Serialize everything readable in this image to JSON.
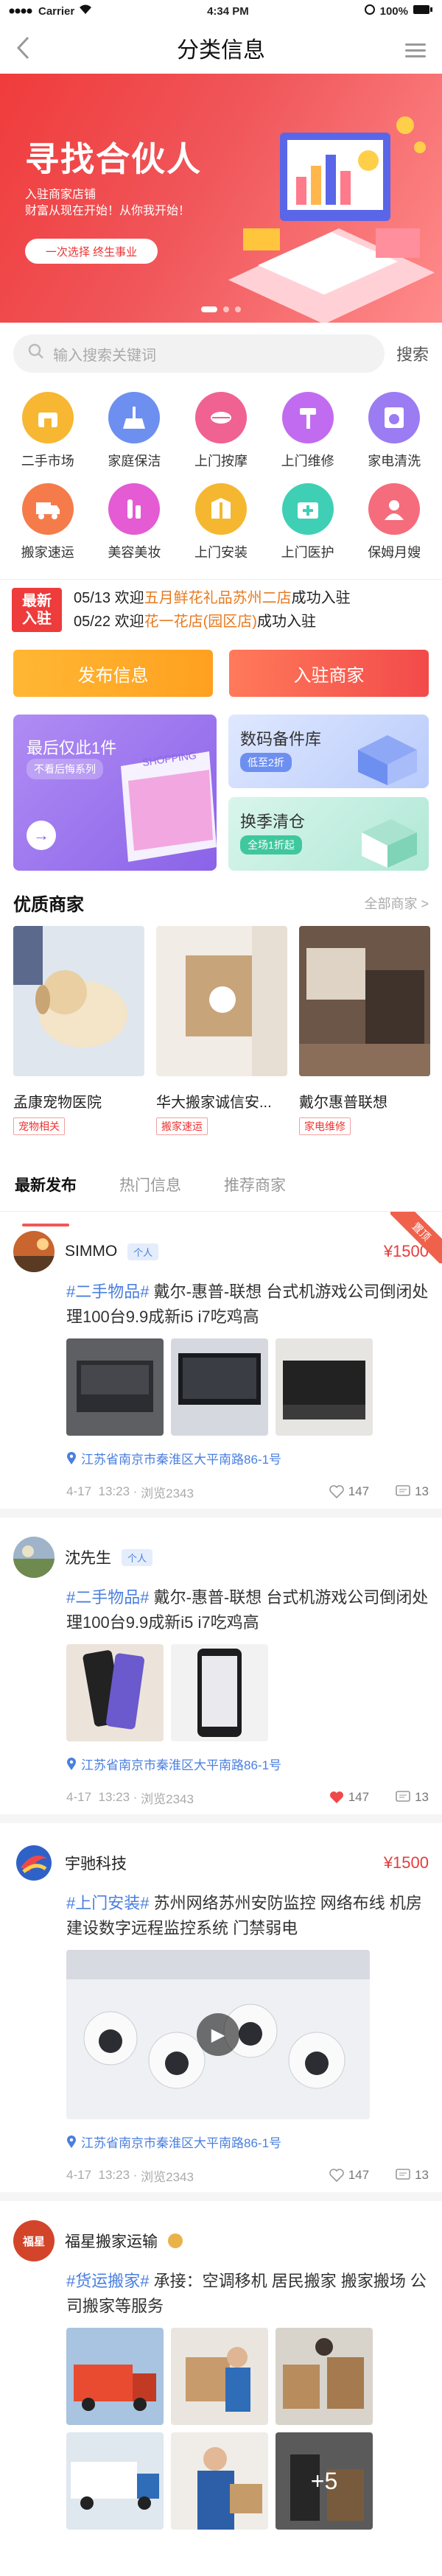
{
  "status_bar": {
    "carrier": "Carrier",
    "time": "4:34 PM",
    "battery": "100%"
  },
  "nav": {
    "title": "分类信息"
  },
  "banner": {
    "title": "寻找合伙人",
    "line1": "入驻商家店铺",
    "line2": "财富从现在开始！从你我开始！",
    "pill": "一次选择 终生事业"
  },
  "search": {
    "placeholder": "输入搜索关键词",
    "button": "搜索"
  },
  "categories": [
    {
      "label": "二手市场",
      "icon": "store-icon",
      "color": "#f7b733"
    },
    {
      "label": "家庭保洁",
      "icon": "broom-icon",
      "color": "#6d8ff0"
    },
    {
      "label": "上门按摩",
      "icon": "lips-icon",
      "color": "#f06292"
    },
    {
      "label": "上门维修",
      "icon": "hammer-icon",
      "color": "#c16cf0"
    },
    {
      "label": "家电清洗",
      "icon": "washer-icon",
      "color": "#9b7cf2"
    },
    {
      "label": "搬家速运",
      "icon": "truck-icon",
      "color": "#f57c4a"
    },
    {
      "label": "美容美妆",
      "icon": "makeup-icon",
      "color": "#e45bd3"
    },
    {
      "label": "上门安装",
      "icon": "box-icon",
      "color": "#f5b730"
    },
    {
      "label": "上门医护",
      "icon": "medical-icon",
      "color": "#3fcfb5"
    },
    {
      "label": "保姆月嫂",
      "icon": "nanny-icon",
      "color": "#f56c7c"
    }
  ],
  "news": {
    "badge_line1": "最新",
    "badge_line2": "入驻",
    "items": [
      {
        "date": "05/13",
        "pre": "欢迎",
        "name": "五月鲜花礼品苏州二店",
        "post": "成功入驻"
      },
      {
        "date": "05/22",
        "pre": "欢迎",
        "name": "花一花店(园区店)",
        "post": "成功入驻"
      }
    ]
  },
  "actions": {
    "publish": "发布信息",
    "join": "入驻商家"
  },
  "promo": {
    "big": {
      "title": "最后仅此1件",
      "subtitle": "不看后悔系列",
      "arrow": "→",
      "art_text": "SHOPPING"
    },
    "card1": {
      "title": "数码备件库",
      "subtitle": "低至2折"
    },
    "card2": {
      "title": "换季清仓",
      "subtitle": "全场1折起"
    }
  },
  "merchants": {
    "title": "优质商家",
    "more": "全部商家 >",
    "items": [
      {
        "name": "孟康宠物医院",
        "tag": "宠物相关"
      },
      {
        "name": "华大搬家诚信安...",
        "tag": "搬家速运"
      },
      {
        "name": "戴尔惠普联想",
        "tag": "家电维修"
      }
    ]
  },
  "tabs": [
    "最新发布",
    "热门信息",
    "推荐商家"
  ],
  "posts": [
    {
      "name": "SIMMO",
      "badge": "个人",
      "price": "¥1500",
      "ribbon": "置顶",
      "topic": "#二手物品#",
      "text": " 戴尔-惠普-联想 台式机游戏公司倒闭处理100台9.9成新i5 i7吃鸡高",
      "location": "江苏省南京市秦淮区大平南路86-1号",
      "date": "4-17",
      "time": "13:23",
      "views": "浏览2343",
      "likes": "147",
      "comments": "13"
    },
    {
      "name": "沈先生",
      "badge": "个人",
      "topic": "#二手物品#",
      "text": " 戴尔-惠普-联想 台式机游戏公司倒闭处理100台9.9成新i5 i7吃鸡高",
      "location": "江苏省南京市秦淮区大平南路86-1号",
      "date": "4-17",
      "time": "13:23",
      "views": "浏览2343",
      "likes": "147",
      "comments": "13"
    },
    {
      "name": "宇驰科技",
      "price": "¥1500",
      "topic": "#上门安装#",
      "text": " 苏州网络苏州安防监控 网络布线 机房建设数字远程监控系统 门禁弱电",
      "location": "江苏省南京市秦淮区大平南路86-1号",
      "date": "4-17",
      "time": "13:23",
      "views": "浏览2343",
      "likes": "147",
      "comments": "13"
    },
    {
      "name": "福星搬家运输",
      "avatar_text": "福星",
      "topic": "#货运搬家#",
      "text": " 承接：空调移机 居民搬家 搬家搬场 公司搬家等服务",
      "more_photos": "+5"
    }
  ]
}
